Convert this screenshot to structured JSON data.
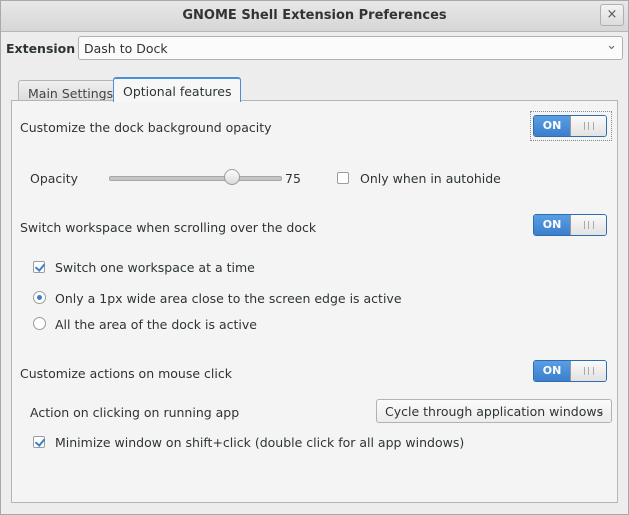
{
  "window": {
    "title": "GNOME Shell Extension Preferences",
    "close_glyph": "×"
  },
  "extension": {
    "label": "Extension",
    "selected": "Dash to Dock",
    "chevron_icon": "chevron-down-icon"
  },
  "tabs": [
    {
      "label": "Main Settings",
      "active": false
    },
    {
      "label": "Optional features",
      "active": true
    }
  ],
  "opacity_section": {
    "label": "Customize the dock background opacity",
    "switch_label": "ON",
    "slider_label": "Opacity",
    "slider_value": "75",
    "autohide_label": "Only when in autohide",
    "autohide_checked": false
  },
  "scroll_section": {
    "label": "Switch workspace when scrolling over the dock",
    "switch_label": "ON",
    "one_at_a_time_label": "Switch one workspace at a time",
    "one_at_a_time_checked": true,
    "radio_edge_label": "Only a 1px wide area close to the screen edge is active",
    "radio_all_label": "All the area of the dock is active",
    "selected_radio": "edge"
  },
  "click_section": {
    "label": "Customize actions on mouse click",
    "switch_label": "ON",
    "action_label": "Action on clicking on running app",
    "action_selected": "Cycle through application windows",
    "minimize_label": "Minimize window on shift+click (double click for all app windows)",
    "minimize_checked": true
  },
  "colors": {
    "accent": "#3b7fcd",
    "background": "#ededed"
  }
}
